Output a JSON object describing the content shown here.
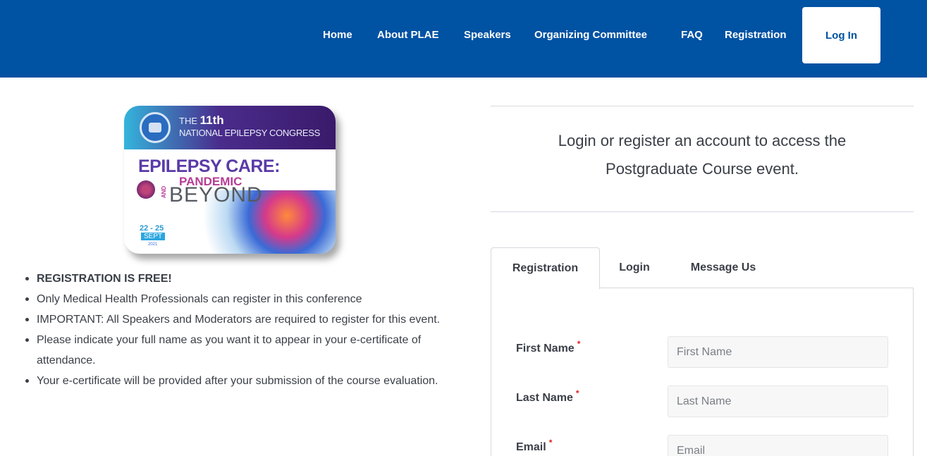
{
  "nav": {
    "items": [
      "Home",
      "About PLAE",
      "Speakers",
      "Organizing Committee",
      "FAQ",
      "Registration"
    ],
    "login_label": "Log In"
  },
  "banner": {
    "the": "THE",
    "edition": "11th",
    "congress": "NATIONAL EPILEPSY CONGRESS",
    "title": "EPILEPSY CARE:",
    "pandemic": "PANDEMIC",
    "and": "AND",
    "beyond": "BEYOND",
    "dates": "22 - 25",
    "month": "SEPT",
    "year": "2021"
  },
  "info": {
    "items": [
      "REGISTRATION IS FREE!",
      "Only Medical Health Professionals can register in this conference",
      "IMPORTANT: All Speakers and Moderators are required to register for this event.",
      "Please indicate your full name as you want it to appear in your e-certificate of attendance.",
      "Your e-certificate will be provided after your submission of the course evaluation."
    ]
  },
  "lead": {
    "line1": "Login or register an account to access the",
    "line2": "Postgraduate Course event."
  },
  "tabs": [
    "Registration",
    "Login",
    "Message Us"
  ],
  "form": {
    "required_mark": "*",
    "fields": [
      {
        "label": "First Name",
        "placeholder": "First Name"
      },
      {
        "label": "Last Name",
        "placeholder": "Last Name"
      },
      {
        "label": "Email",
        "placeholder": "Email"
      }
    ]
  }
}
